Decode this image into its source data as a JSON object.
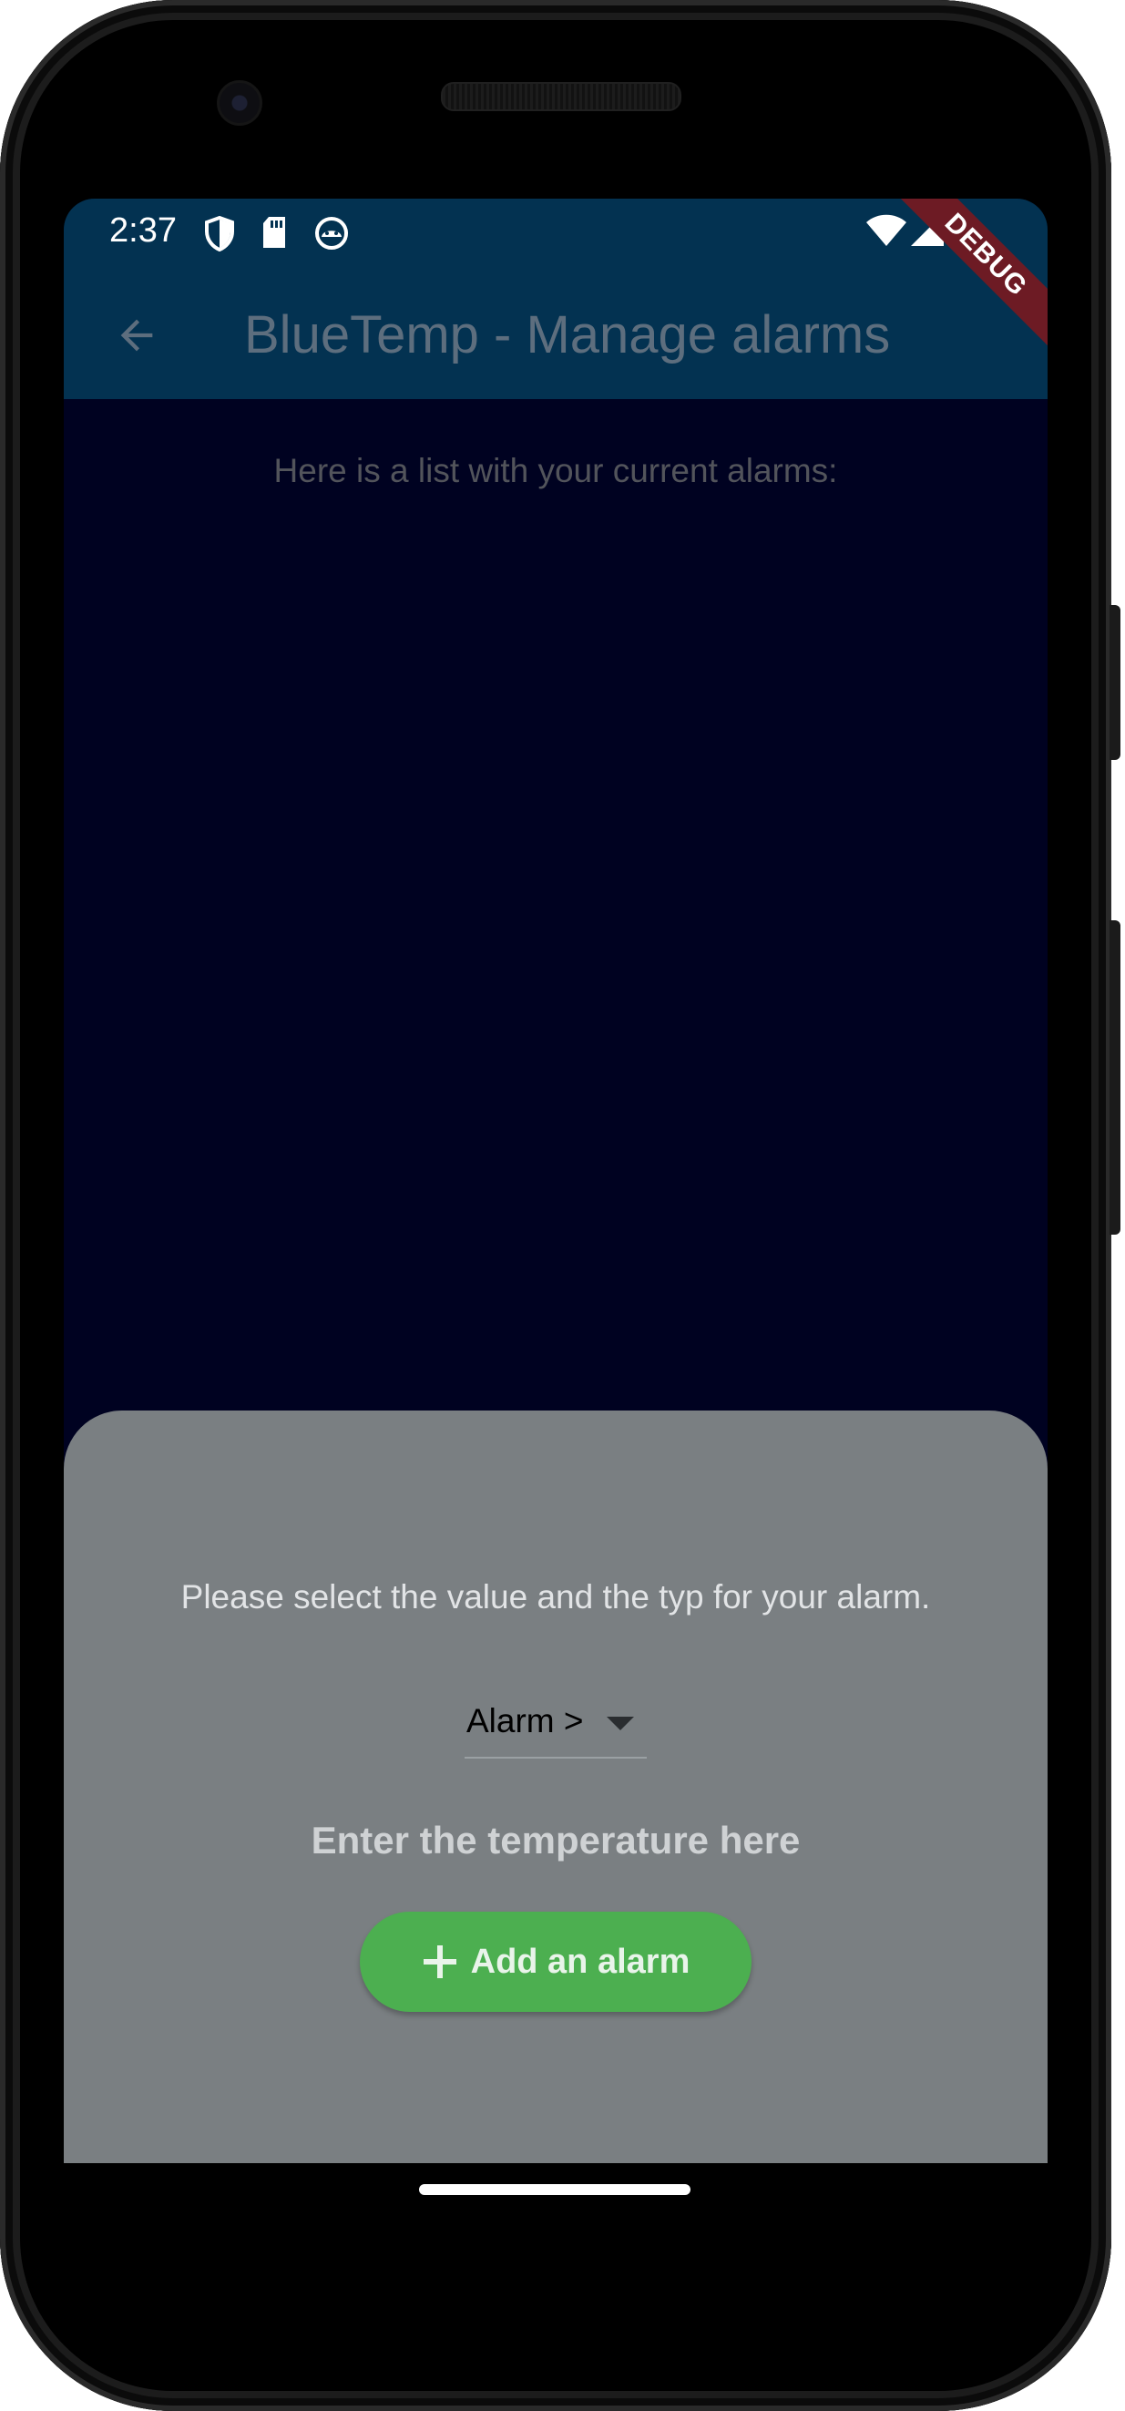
{
  "status_bar": {
    "time": "2:37",
    "icons": [
      "shield-icon",
      "sd-card-icon",
      "android-debug-icon",
      "wifi-icon",
      "cell-signal-icon"
    ]
  },
  "debug_banner": "DEBUG",
  "app_bar": {
    "title": "BlueTemp - Manage alarms",
    "back_icon": "arrow-back-icon"
  },
  "main": {
    "list_caption": "Here is a list with your current alarms:"
  },
  "bottom_sheet": {
    "prompt": "Please select the value and the typ for your alarm.",
    "alarm_type_dropdown": {
      "selected": "Alarm >"
    },
    "temperature_input": {
      "placeholder": "Enter the temperature here"
    },
    "add_button": {
      "label": "Add an alarm",
      "icon": "plus-icon"
    }
  },
  "colors": {
    "app_bar": "#033251",
    "background": "#000221",
    "sheet": "#7a7f82",
    "add_button": "#4caf50",
    "debug_banner": "#6d1b24"
  }
}
